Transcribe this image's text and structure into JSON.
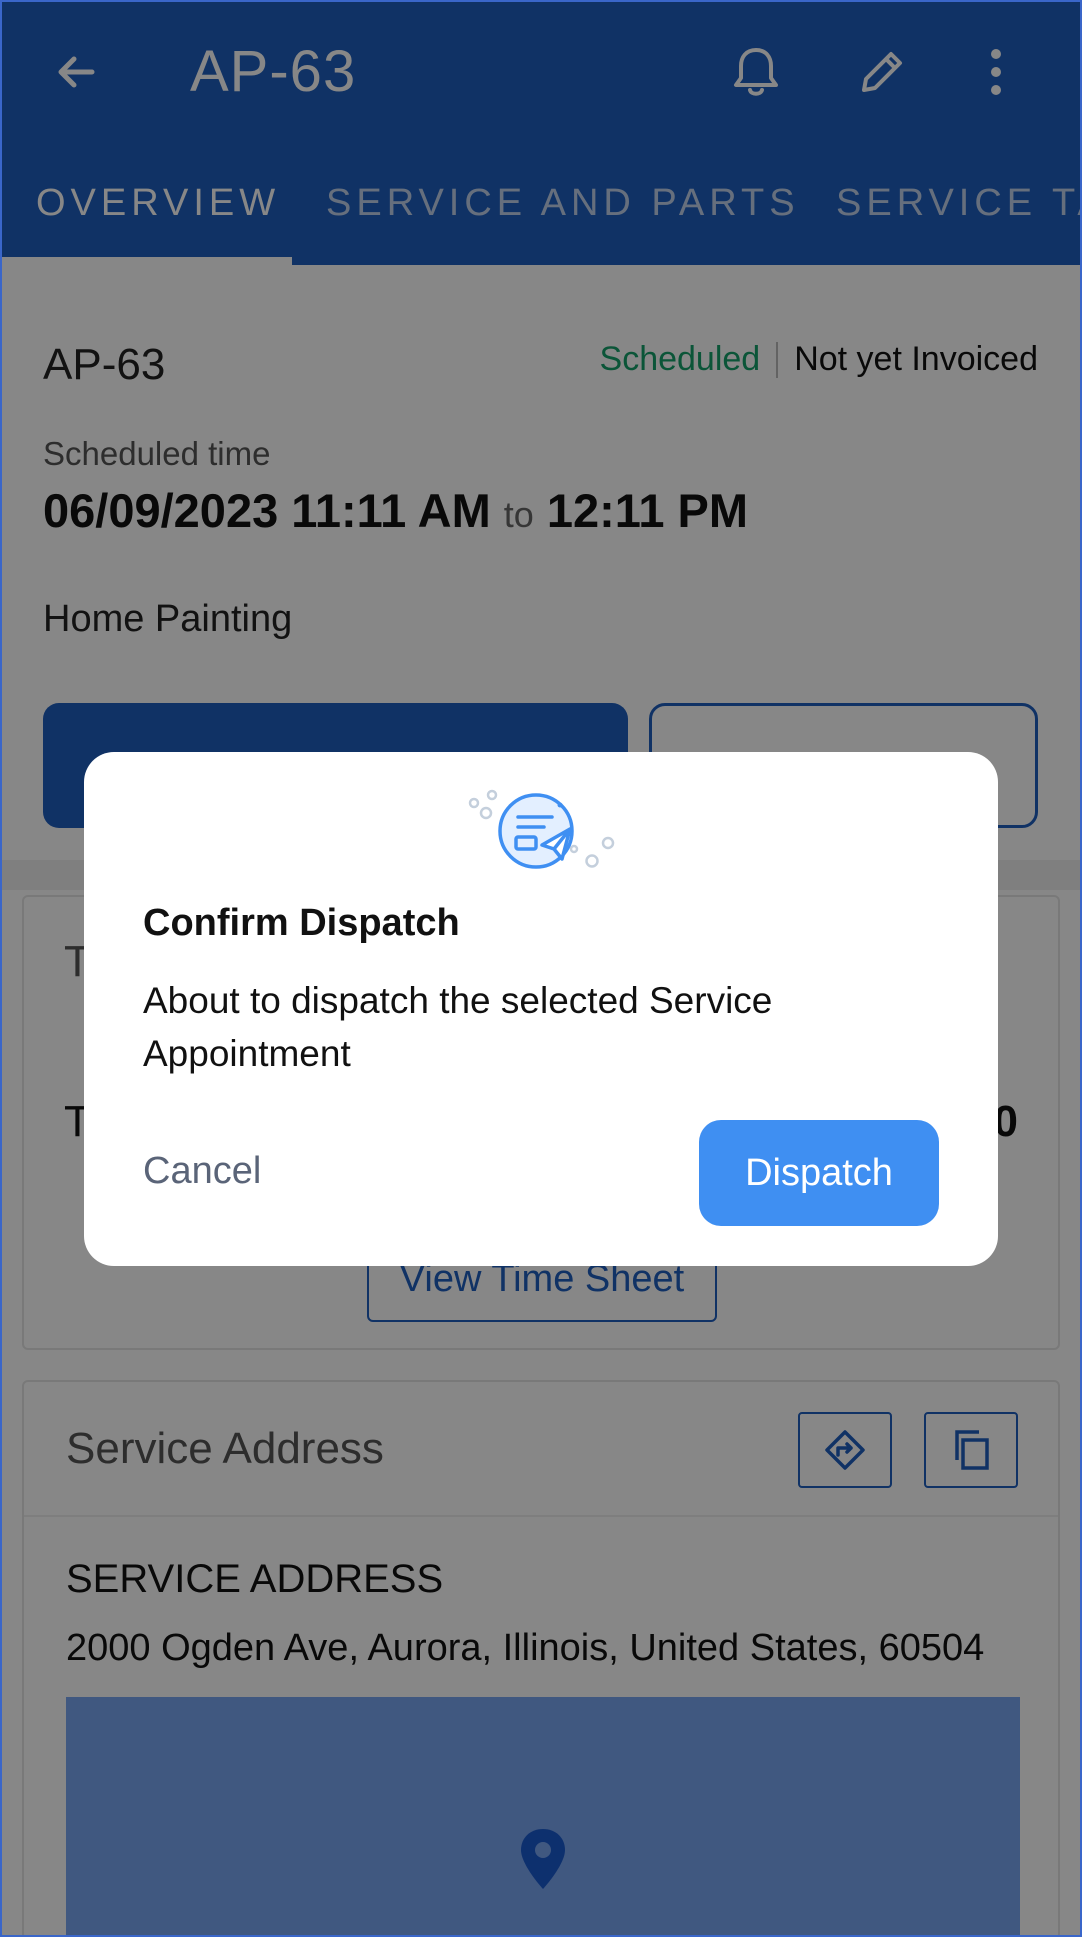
{
  "appbar": {
    "title": "AP-63",
    "tabs": [
      {
        "label": "OVERVIEW",
        "active": true
      },
      {
        "label": "SERVICE AND PARTS",
        "active": false
      },
      {
        "label": "SERVICE TA",
        "active": false
      }
    ],
    "icons": [
      "back-arrow-icon",
      "bell-icon",
      "pencil-icon",
      "more-vert-icon"
    ]
  },
  "appointment": {
    "id": "AP-63",
    "status": "Scheduled",
    "invoice_status": "Not yet Invoiced",
    "scheduled_label": "Scheduled time",
    "start": "06/09/2023 11:11 AM",
    "to": "to",
    "end": "12:11 PM",
    "service": "Home Painting"
  },
  "timesheet_card": {
    "title_fragment": "T",
    "row_label_fragment": "T",
    "row_value_fragment": "0",
    "button_label": "View Time Sheet"
  },
  "address_card": {
    "title": "Service Address",
    "heading": "SERVICE ADDRESS",
    "address": "2000 Ogden Ave, Aurora, Illinois, United States, 60504",
    "icons": [
      "directions-icon",
      "copy-icon",
      "map-pin-icon"
    ]
  },
  "dialog": {
    "title": "Confirm Dispatch",
    "message": "About to dispatch the selected Service Appointment",
    "cancel_label": "Cancel",
    "confirm_label": "Dispatch"
  },
  "colors": {
    "primary": "#1f5fbf",
    "accent_button": "#3f8ff2",
    "scheduled_green": "#16a06b",
    "scrim": "rgba(0,0,0,0.47)"
  }
}
